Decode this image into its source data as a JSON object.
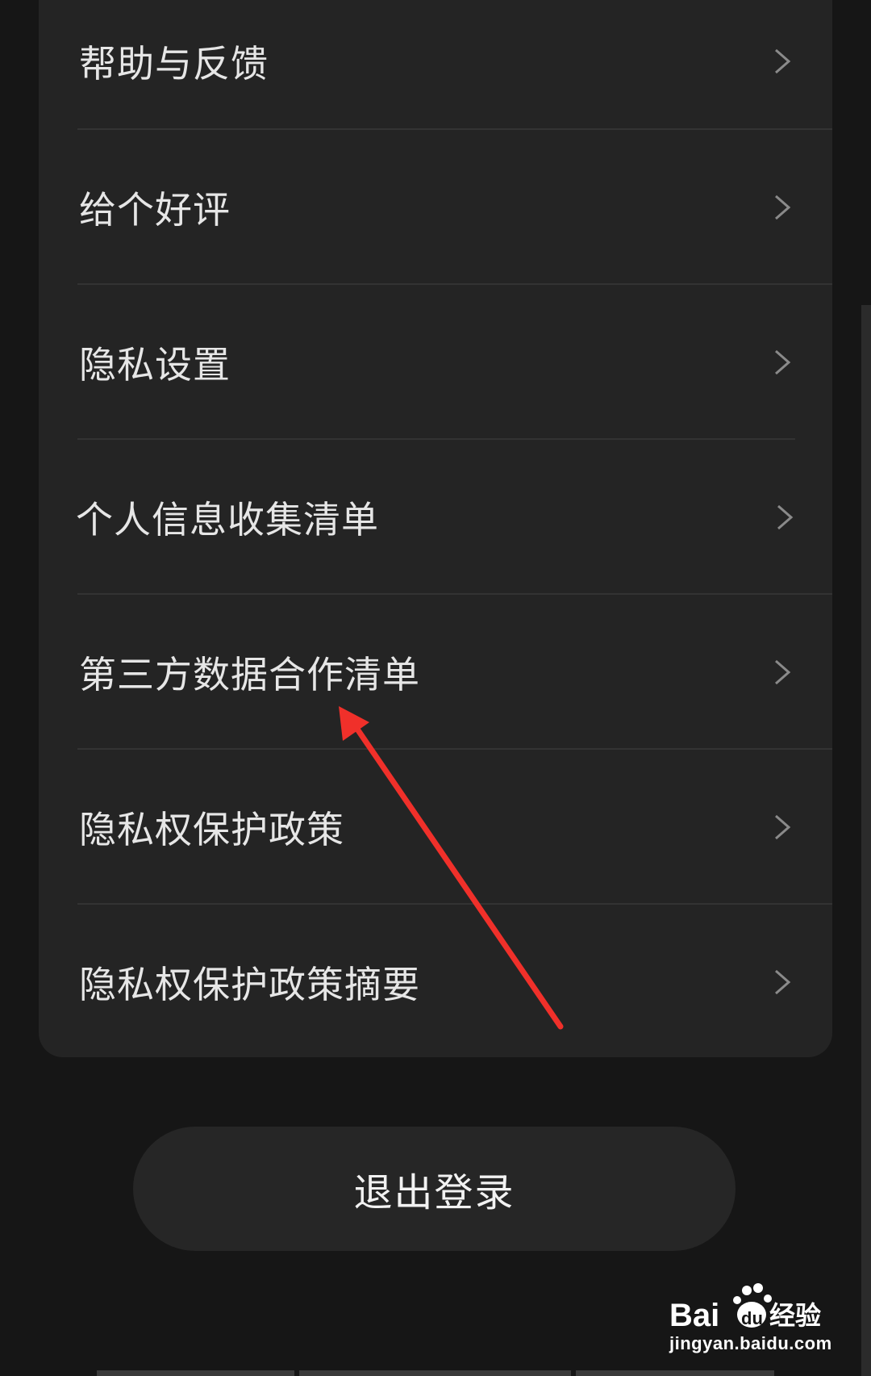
{
  "menu": {
    "items": [
      {
        "label": "帮助与反馈"
      },
      {
        "label": "给个好评"
      },
      {
        "label": "隐私设置"
      },
      {
        "label": "个人信息收集清单"
      },
      {
        "label": "第三方数据合作清单"
      },
      {
        "label": "隐私权保护政策"
      },
      {
        "label": "隐私权保护政策摘要"
      }
    ]
  },
  "logout_label": "退出登录",
  "watermark": {
    "brand": "Bai du 经验",
    "url": "jingyan.baidu.com"
  },
  "colors": {
    "background": "#161616",
    "card": "#242424",
    "text": "#e6e6e6",
    "arrow": "#f0302a"
  },
  "icons": {
    "row_chevron": "chevron-right-icon",
    "annotation": "red-arrow-icon"
  }
}
